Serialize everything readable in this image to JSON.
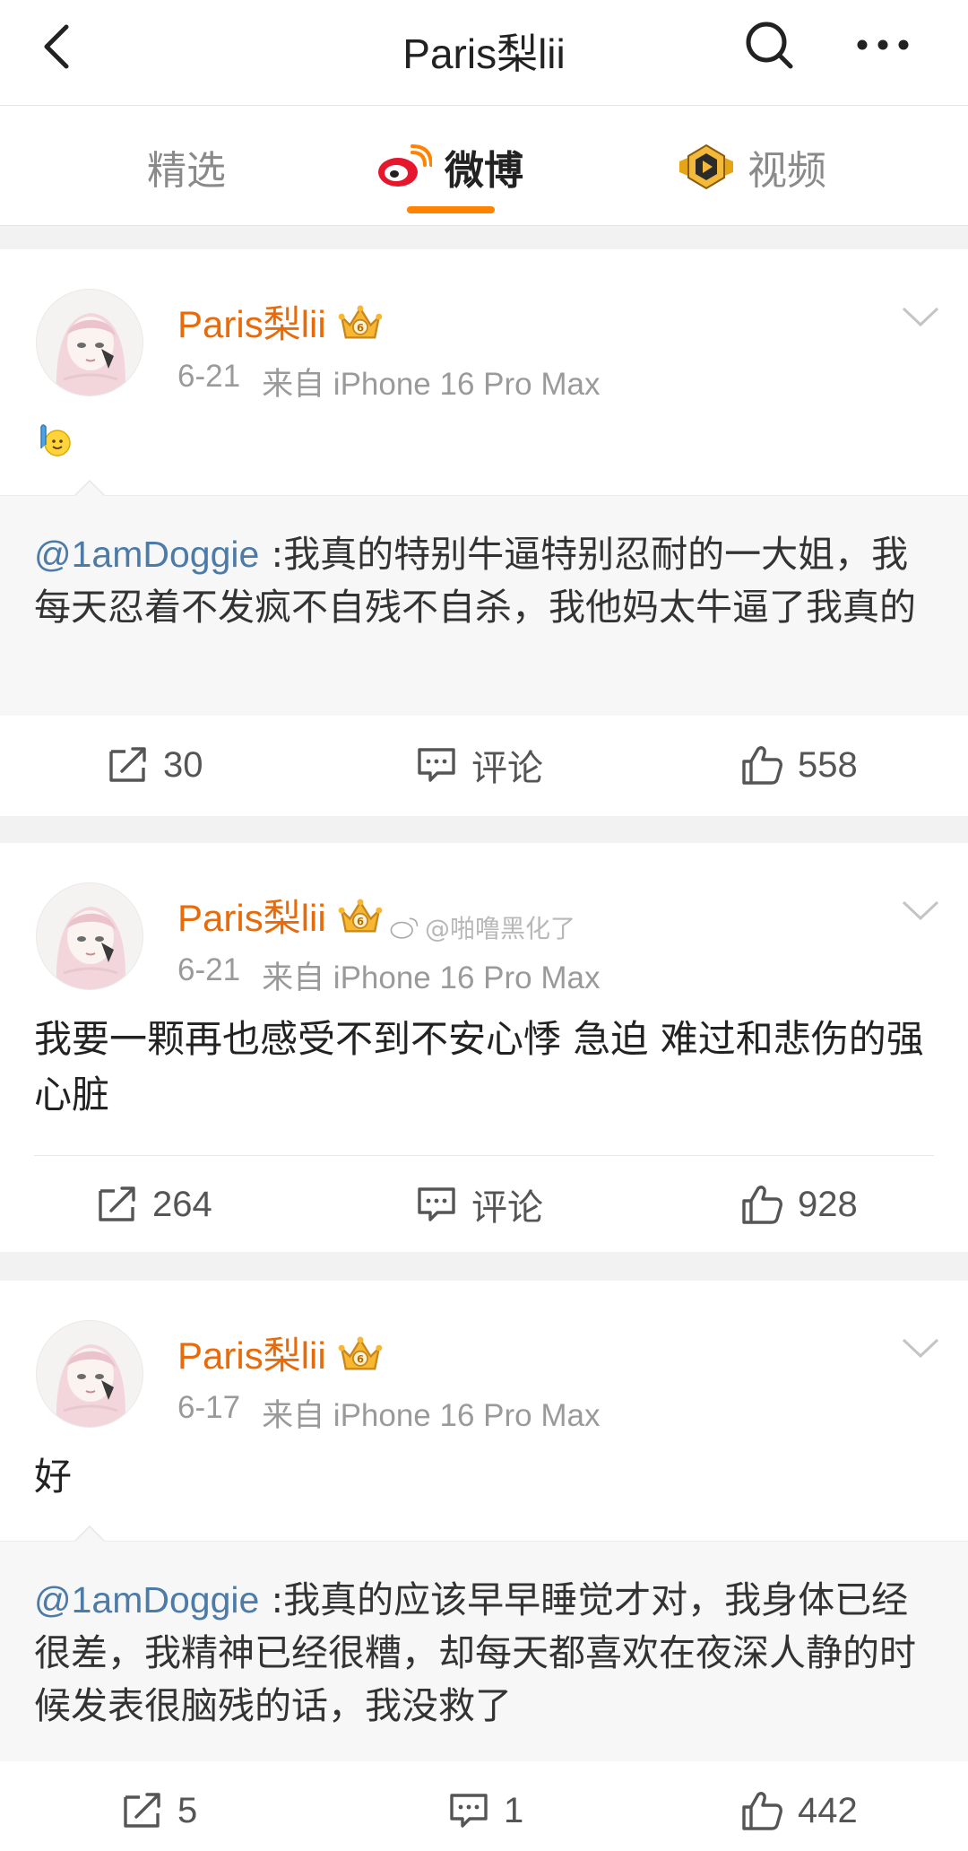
{
  "header": {
    "title": "Paris梨lii"
  },
  "tabs": [
    {
      "label": "精选"
    },
    {
      "label": "微博"
    },
    {
      "label": "视频"
    }
  ],
  "colors": {
    "accent": "#ff8200",
    "username": "#e86b0b",
    "mention": "#4c7ba8"
  },
  "watermark": "@啪噜黑化了",
  "posts": [
    {
      "author": "Paris梨lii",
      "date": "6-21",
      "source": "来自 iPhone 16 Pro Max",
      "text": "",
      "emoji": "raise-hand-emoji",
      "repost": {
        "mention": "@1amDoggie",
        "text": " :我真的特别牛逼特别忍耐的一大姐，我每天忍着不发疯不自残不自杀，我他妈太牛逼了我真的"
      },
      "reposts": "30",
      "comments": "评论",
      "likes": "558"
    },
    {
      "author": "Paris梨lii",
      "date": "6-21",
      "source": "来自 iPhone 16 Pro Max",
      "text": "我要一颗再也感受不到不安心悸 急迫 难过和悲伤的强心脏",
      "reposts": "264",
      "comments": "评论",
      "likes": "928"
    },
    {
      "author": "Paris梨lii",
      "date": "6-17",
      "source": "来自 iPhone 16 Pro Max",
      "text": "好",
      "repost": {
        "mention": "@1amDoggie",
        "text": " :我真的应该早早睡觉才对，我身体已经很差，我精神已经很糟，却每天都喜欢在夜深人静的时候发表很脑残的话，我没救了"
      },
      "reposts": "5",
      "comments": "1",
      "likes": "442"
    }
  ]
}
